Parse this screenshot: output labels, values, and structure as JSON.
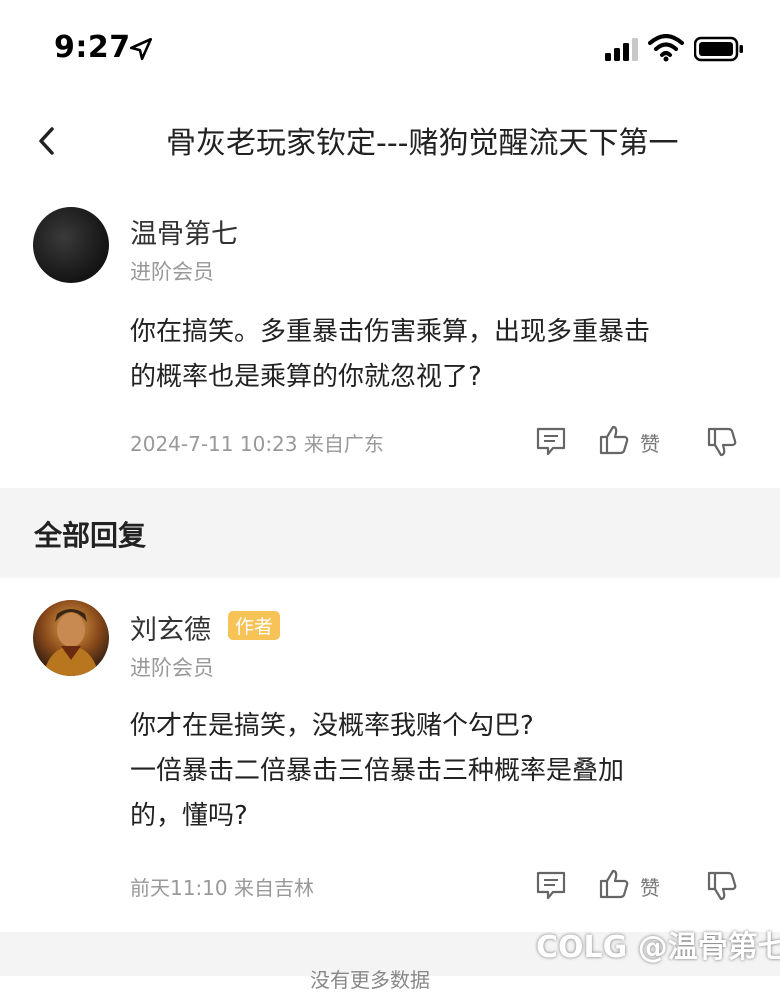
{
  "status_bar": {
    "time": "9:27"
  },
  "header": {
    "title": "骨灰老玩家钦定---赌狗觉醒流天下第一"
  },
  "main_post": {
    "username": "温骨第七",
    "level": "进阶会员",
    "content_line1": "你在搞笑。多重暴击伤害乘算，出现多重暴击",
    "content_line2": "的概率也是乘算的你就忽视了?",
    "date": "2024-7-11 10:23",
    "location": "来自广东",
    "like_label": "赞"
  },
  "replies_section": {
    "title": "全部回复"
  },
  "reply": {
    "username": "刘玄德",
    "author_tag": "作者",
    "level": "进阶会员",
    "content_line1": "你才在是搞笑，没概率我赌个勾巴?",
    "content_line2": "一倍暴击二倍暴击三倍暴击三种概率是叠加",
    "content_line3": "的，懂吗?",
    "date": "前天11:10",
    "location": "来自吉林",
    "like_label": "赞"
  },
  "footer": {
    "text": "没有更多数据"
  },
  "watermark": {
    "text": "COLG @温骨第七"
  }
}
